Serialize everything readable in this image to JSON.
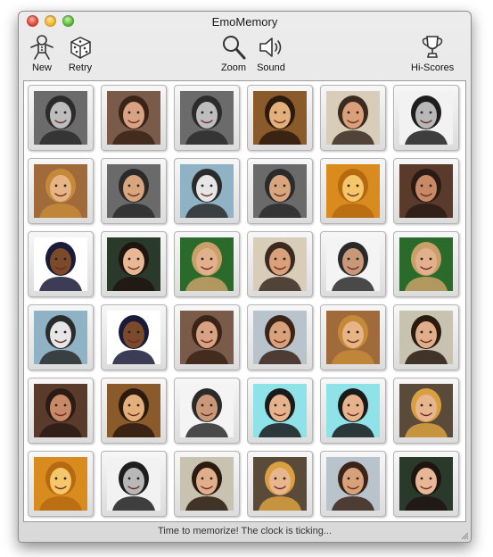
{
  "window": {
    "title": "EmoMemory"
  },
  "toolbar": {
    "new_label": "New",
    "retry_label": "Retry",
    "zoom_label": "Zoom",
    "sound_label": "Sound",
    "hiscores_label": "Hi-Scores"
  },
  "status": {
    "text": "Time to memorize! The clock is ticking..."
  },
  "tiles": [
    {
      "face": "gray-long-hair-woman",
      "bg": "#6b6b6b",
      "skin": "#bdbdbd",
      "hair": "#2b2b2b"
    },
    {
      "face": "sepia-lying-woman",
      "bg": "#7a5a48",
      "skin": "#d9a383",
      "hair": "#3a2418"
    },
    {
      "face": "gray-long-hair-woman",
      "bg": "#6b6b6b",
      "skin": "#bdbdbd",
      "hair": "#2b2b2b"
    },
    {
      "face": "smiling-woman-dark-hair",
      "bg": "#8a5a2a",
      "skin": "#e3b07c",
      "hair": "#2c1a0e"
    },
    {
      "face": "bald-man-newspaper",
      "bg": "#d8cdb8",
      "skin": "#d9a07a",
      "hair": "#3a2a20"
    },
    {
      "face": "bw-man-white",
      "bg": "#f2f2f2",
      "skin": "#b8b8b8",
      "hair": "#1e1e1e"
    },
    {
      "face": "blonde-curly-woman",
      "bg": "#a06a3a",
      "skin": "#e7b486",
      "hair": "#c48a3a"
    },
    {
      "face": "man-sunglasses",
      "bg": "#6a6a6a",
      "skin": "#d8a57e",
      "hair": "#2a2a2a"
    },
    {
      "face": "clown-guitar",
      "bg": "#8fb2c4",
      "skin": "#e6e6e6",
      "hair": "#2b2b2b"
    },
    {
      "face": "man-sunglasses",
      "bg": "#6a6a6a",
      "skin": "#d8a57e",
      "hair": "#2a2a2a"
    },
    {
      "face": "yellow-tint-woman",
      "bg": "#d98b1e",
      "skin": "#f5c66a",
      "hair": "#b56a10"
    },
    {
      "face": "bald-man-grimace",
      "bg": "#5a3a2a",
      "skin": "#c88a66",
      "hair": "#2a1c14"
    },
    {
      "face": "dreadlocks-man",
      "bg": "#ffffff",
      "skin": "#7a4a2a",
      "hair": "#1a1a3a"
    },
    {
      "face": "brunette-woman-smile",
      "bg": "#2a3a2a",
      "skin": "#e8b896",
      "hair": "#1e1410"
    },
    {
      "face": "blond-man-smile",
      "bg": "#2a6a2a",
      "skin": "#e3b08e",
      "hair": "#c9a068"
    },
    {
      "face": "bald-man-newspaper",
      "bg": "#d8cdb8",
      "skin": "#d9a07a",
      "hair": "#3a2a20"
    },
    {
      "face": "laughing-man-phone",
      "bg": "#f4f4f4",
      "skin": "#c89878",
      "hair": "#2a2a2a"
    },
    {
      "face": "blond-man-smile",
      "bg": "#2a6a2a",
      "skin": "#e3b08e",
      "hair": "#c9a068"
    },
    {
      "face": "clown-guitar",
      "bg": "#8fb2c4",
      "skin": "#e6e6e6",
      "hair": "#2b2b2b"
    },
    {
      "face": "dreadlocks-man",
      "bg": "#ffffff",
      "skin": "#7a4a2a",
      "hair": "#1a1a3a"
    },
    {
      "face": "sepia-lying-woman",
      "bg": "#7a5a48",
      "skin": "#d9a383",
      "hair": "#3a2418"
    },
    {
      "face": "beach-mother-child",
      "bg": "#b9c3cc",
      "skin": "#d7a27a",
      "hair": "#3a2418"
    },
    {
      "face": "blonde-curly-woman",
      "bg": "#a06a3a",
      "skin": "#e7b486",
      "hair": "#c48a3a"
    },
    {
      "face": "brunette-waving",
      "bg": "#c8c2b0",
      "skin": "#e0ae8a",
      "hair": "#2a1a10"
    },
    {
      "face": "bald-man-grimace",
      "bg": "#5a3a2a",
      "skin": "#c88a66",
      "hair": "#2a1c14"
    },
    {
      "face": "smiling-woman-dark-hair",
      "bg": "#8a5a2a",
      "skin": "#e3b07c",
      "hair": "#2c1a0e"
    },
    {
      "face": "laughing-man-phone",
      "bg": "#f4f4f4",
      "skin": "#c89878",
      "hair": "#2a2a2a"
    },
    {
      "face": "profile-woman-cyan",
      "bg": "#8fe2e8",
      "skin": "#e6b38c",
      "hair": "#1a1a1a"
    },
    {
      "face": "profile-woman-cyan",
      "bg": "#8fe2e8",
      "skin": "#e6b38c",
      "hair": "#1a1a1a"
    },
    {
      "face": "straw-hat-woman",
      "bg": "#5a4a3a",
      "skin": "#e7b58e",
      "hair": "#d9a040"
    },
    {
      "face": "yellow-tint-woman",
      "bg": "#d98b1e",
      "skin": "#f5c66a",
      "hair": "#b56a10"
    },
    {
      "face": "bw-man-white",
      "bg": "#f2f2f2",
      "skin": "#b8b8b8",
      "hair": "#1e1e1e"
    },
    {
      "face": "brunette-waving",
      "bg": "#c8c2b0",
      "skin": "#e0ae8a",
      "hair": "#2a1a10"
    },
    {
      "face": "straw-hat-woman",
      "bg": "#5a4a3a",
      "skin": "#e7b58e",
      "hair": "#d9a040"
    },
    {
      "face": "beach-mother-child",
      "bg": "#b9c3cc",
      "skin": "#d7a27a",
      "hair": "#3a2418"
    },
    {
      "face": "brunette-woman-smile",
      "bg": "#2a3a2a",
      "skin": "#e8b896",
      "hair": "#1e1410"
    }
  ]
}
